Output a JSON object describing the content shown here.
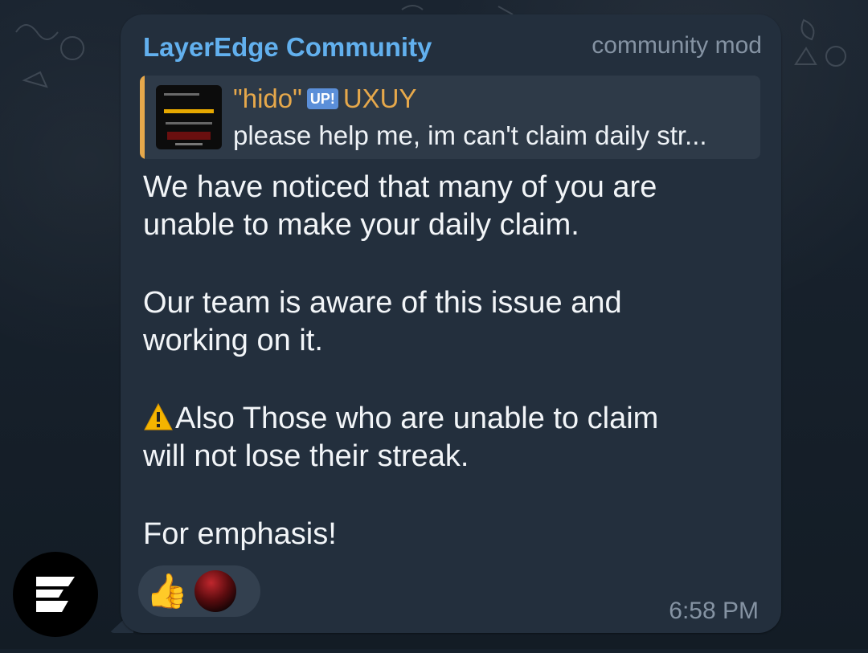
{
  "chat": {
    "sender": "LayerEdge Community",
    "role": "community mod",
    "reply": {
      "name_prefix": "\"hido\"",
      "badge": "UP!",
      "name_suffix": "UXUY",
      "text": "please help me, im can't claim daily str..."
    },
    "message": {
      "p1a": "We have noticed that many of you are",
      "p1b": "unable to make your daily claim.",
      "p2a": "Our team is aware of this issue and",
      "p2b": "working on it.",
      "p3a": "Also Those who are unable to claim",
      "p3b": "will not lose their streak.",
      "p4": "For emphasis!"
    },
    "reactions": {
      "thumbs": "👍"
    },
    "time": "6:58 PM"
  },
  "icons": {
    "warning": "warning-icon",
    "reply_image": "reply-thumbnail",
    "avatar_logo": "layeredge-logo-icon"
  },
  "colors": {
    "sender": "#62b0ee",
    "reply_accent": "#e6a84b",
    "bubble": "#232f3d"
  }
}
